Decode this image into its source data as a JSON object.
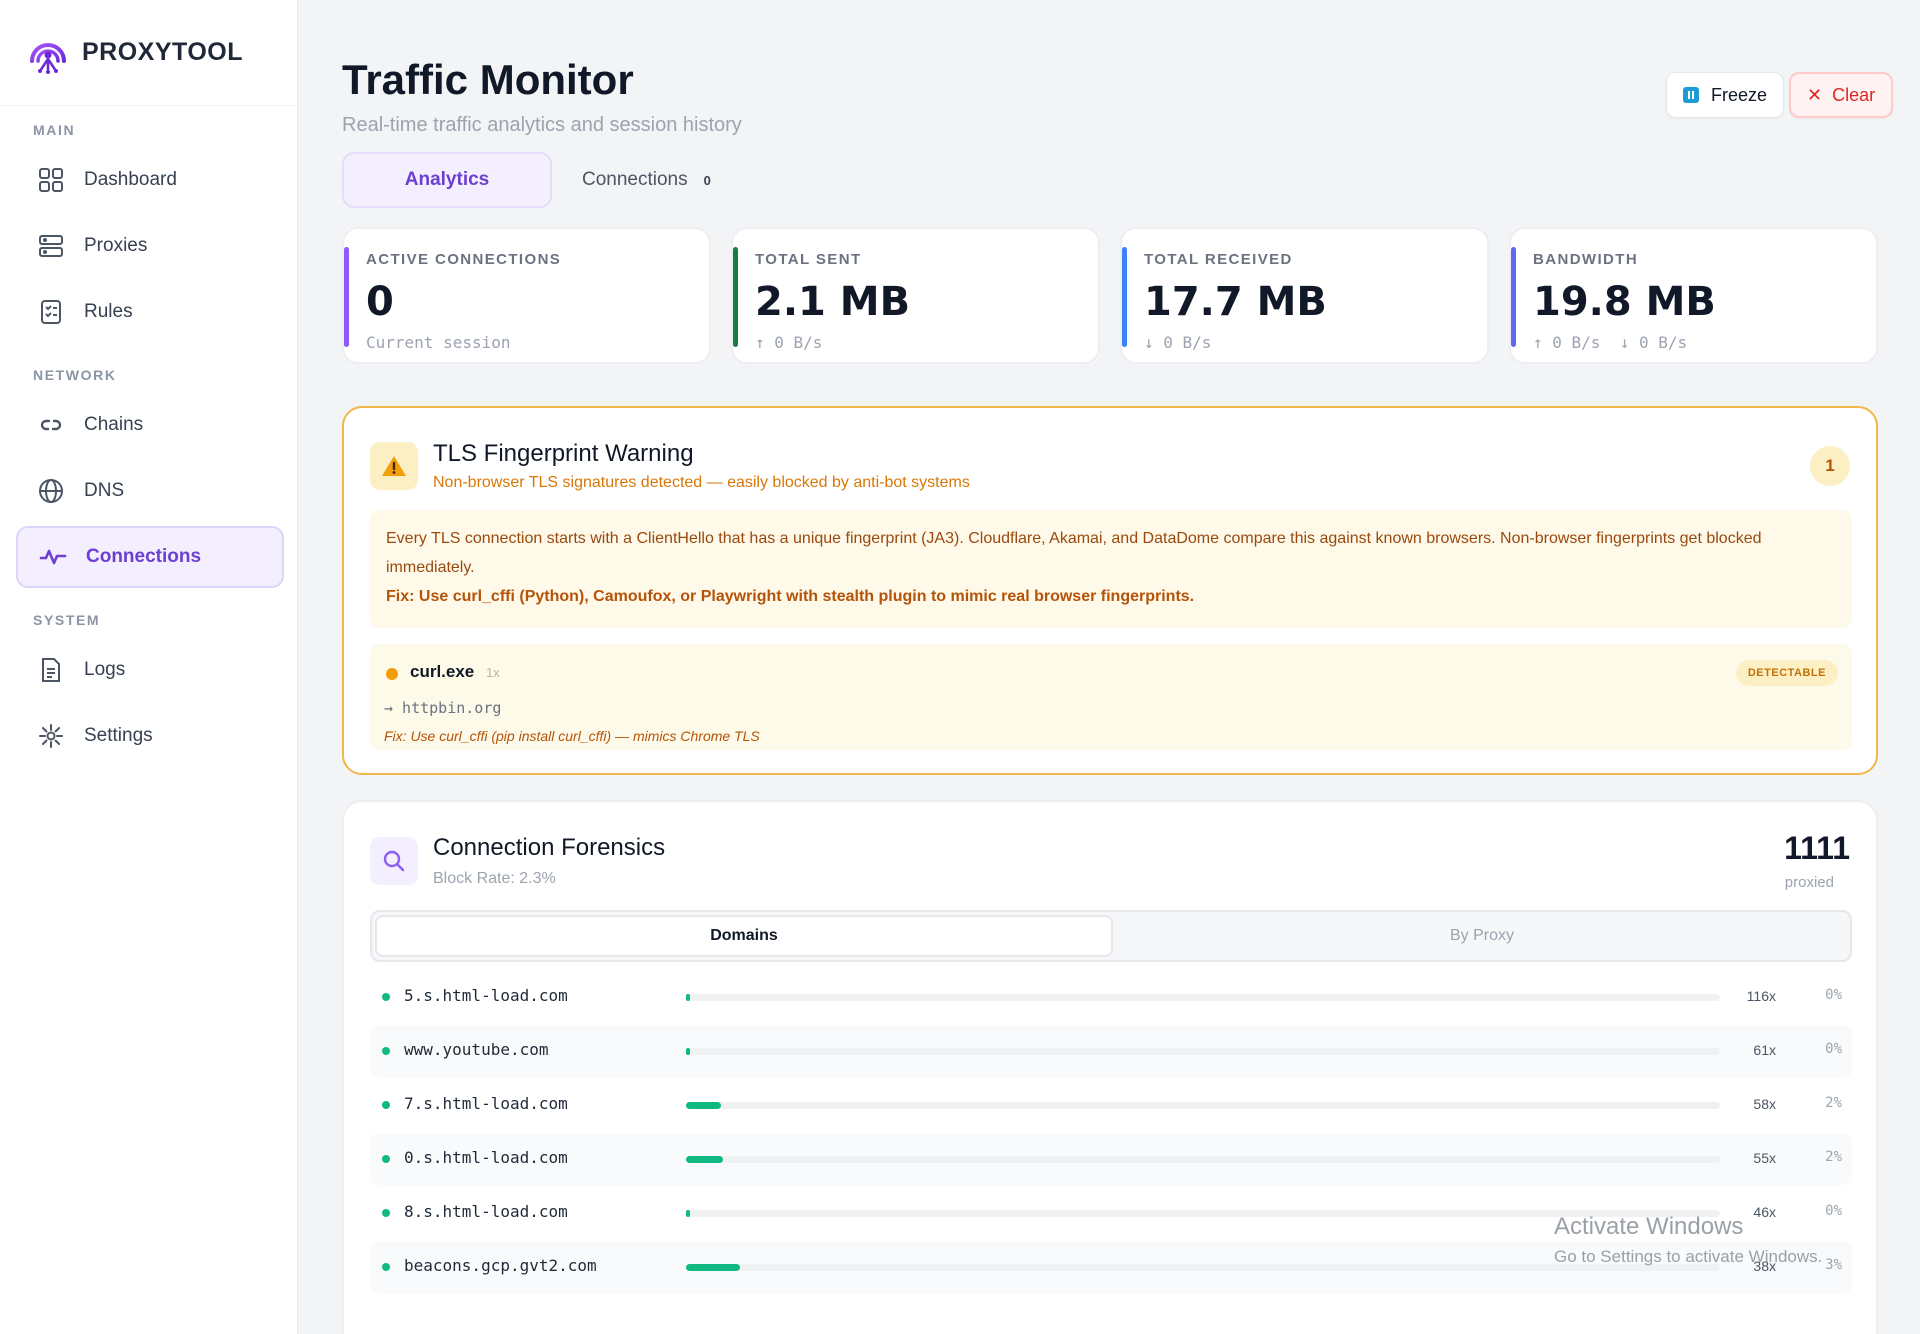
{
  "app": {
    "name": "PROXYTOOL"
  },
  "sidebar": {
    "sections": [
      "MAIN",
      "NETWORK",
      "SYSTEM"
    ],
    "items": [
      {
        "label": "Dashboard",
        "icon": "grid-icon"
      },
      {
        "label": "Proxies",
        "icon": "server-icon"
      },
      {
        "label": "Rules",
        "icon": "checklist-icon"
      },
      {
        "label": "Chains",
        "icon": "link-icon"
      },
      {
        "label": "DNS",
        "icon": "globe-icon"
      },
      {
        "label": "Connections",
        "icon": "activity-icon",
        "active": true
      },
      {
        "label": "Logs",
        "icon": "file-icon"
      },
      {
        "label": "Settings",
        "icon": "gear-icon"
      }
    ]
  },
  "header": {
    "title": "Traffic Monitor",
    "subtitle": "Real-time traffic analytics and session history",
    "freeze_label": "Freeze",
    "clear_label": "Clear"
  },
  "tabs": {
    "analytics": "Analytics",
    "connections": "Connections",
    "connections_count": "0"
  },
  "stats": [
    {
      "label": "ACTIVE CONNECTIONS",
      "value": "0",
      "sub": "Current session",
      "color": "#8b5cf6"
    },
    {
      "label": "TOTAL SENT",
      "value": "2.1 MB",
      "sub": "↑ 0 B/s",
      "color": "#15803d"
    },
    {
      "label": "TOTAL RECEIVED",
      "value": "17.7 MB",
      "sub": "↓ 0 B/s",
      "color": "#3b82f6"
    },
    {
      "label": "BANDWIDTH",
      "value": "19.8 MB",
      "sub": "↑ 0 B/s  ↓ 0 B/s",
      "color": "#6366f1"
    }
  ],
  "tls": {
    "title": "TLS Fingerprint Warning",
    "subtitle": "Non-browser TLS signatures detected — easily blocked by anti-bot systems",
    "badge": "1",
    "info": "Every TLS connection starts with a ClientHello that has a unique fingerprint (JA3). Cloudflare, Akamai, and DataDome compare this against known browsers. Non-browser fingerprints get blocked immediately.",
    "fix": "Fix: Use curl_cffi (Python), Camoufox, or Playwright with stealth plugin to mimic real browser fingerprints.",
    "item": {
      "process": "curl.exe",
      "count": "1x",
      "host": "→ httpbin.org",
      "fix": "Fix: Use curl_cffi (pip install curl_cffi) — mimics Chrome TLS",
      "status": "DETECTABLE"
    }
  },
  "forensics": {
    "title": "Connection Forensics",
    "subtitle": "Block Rate: 2.3%",
    "total": "1111",
    "total_label": "proxied",
    "tab_domains": "Domains",
    "tab_proxy": "By Proxy",
    "rows": [
      {
        "domain": "5.s.html-load.com",
        "hits": "116x",
        "pct": "0%",
        "bar_fraction": 0.004
      },
      {
        "domain": "www.youtube.com",
        "hits": "61x",
        "pct": "0%",
        "bar_fraction": 0.004
      },
      {
        "domain": "7.s.html-load.com",
        "hits": "58x",
        "pct": "2%",
        "bar_fraction": 0.034
      },
      {
        "domain": "0.s.html-load.com",
        "hits": "55x",
        "pct": "2%",
        "bar_fraction": 0.036
      },
      {
        "domain": "8.s.html-load.com",
        "hits": "46x",
        "pct": "0%",
        "bar_fraction": 0.004
      },
      {
        "domain": "beacons.gcp.gvt2.com",
        "hits": "38x",
        "pct": "3%",
        "bar_fraction": 0.052
      }
    ]
  },
  "watermark": {
    "line1": "Activate Windows",
    "line2": "Go to Settings to activate Windows."
  }
}
